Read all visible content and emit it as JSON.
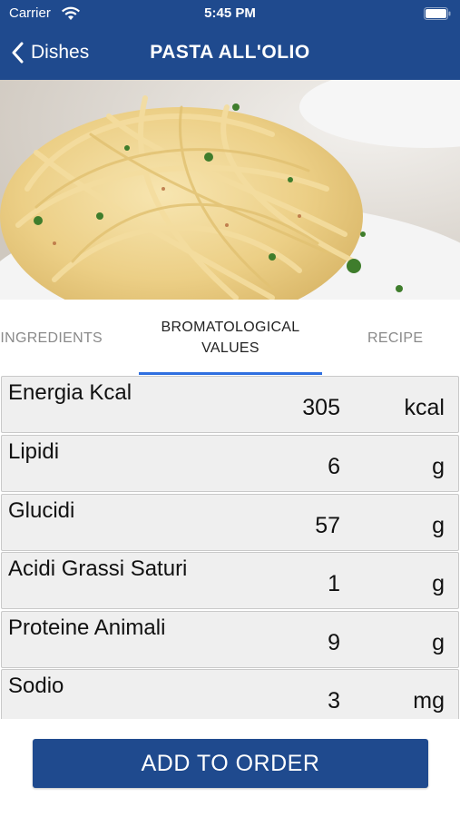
{
  "status_bar": {
    "carrier": "Carrier",
    "time": "5:45 PM"
  },
  "nav": {
    "back_label": "Dishes",
    "title": "PASTA ALL'OLIO"
  },
  "tabs": {
    "ingredients": "INGREDIENTS",
    "bromatological": "BROMATOLOGICAL VALUES",
    "recipe": "RECIPE",
    "selected": "bromatological"
  },
  "nutrients": [
    {
      "name": "Energia Kcal",
      "value": "305",
      "unit": "kcal"
    },
    {
      "name": "Lipidi",
      "value": "6",
      "unit": "g"
    },
    {
      "name": "Glucidi",
      "value": "57",
      "unit": "g"
    },
    {
      "name": "Acidi Grassi Saturi",
      "value": "1",
      "unit": "g"
    },
    {
      "name": "Proteine Animali",
      "value": "9",
      "unit": "g"
    },
    {
      "name": "Sodio",
      "value": "3",
      "unit": "mg"
    }
  ],
  "actions": {
    "add_to_order": "ADD TO ORDER"
  },
  "colors": {
    "header": "#1f4a8e",
    "tab_indicator": "#2f6fe0",
    "button": "#1f4a8e"
  }
}
